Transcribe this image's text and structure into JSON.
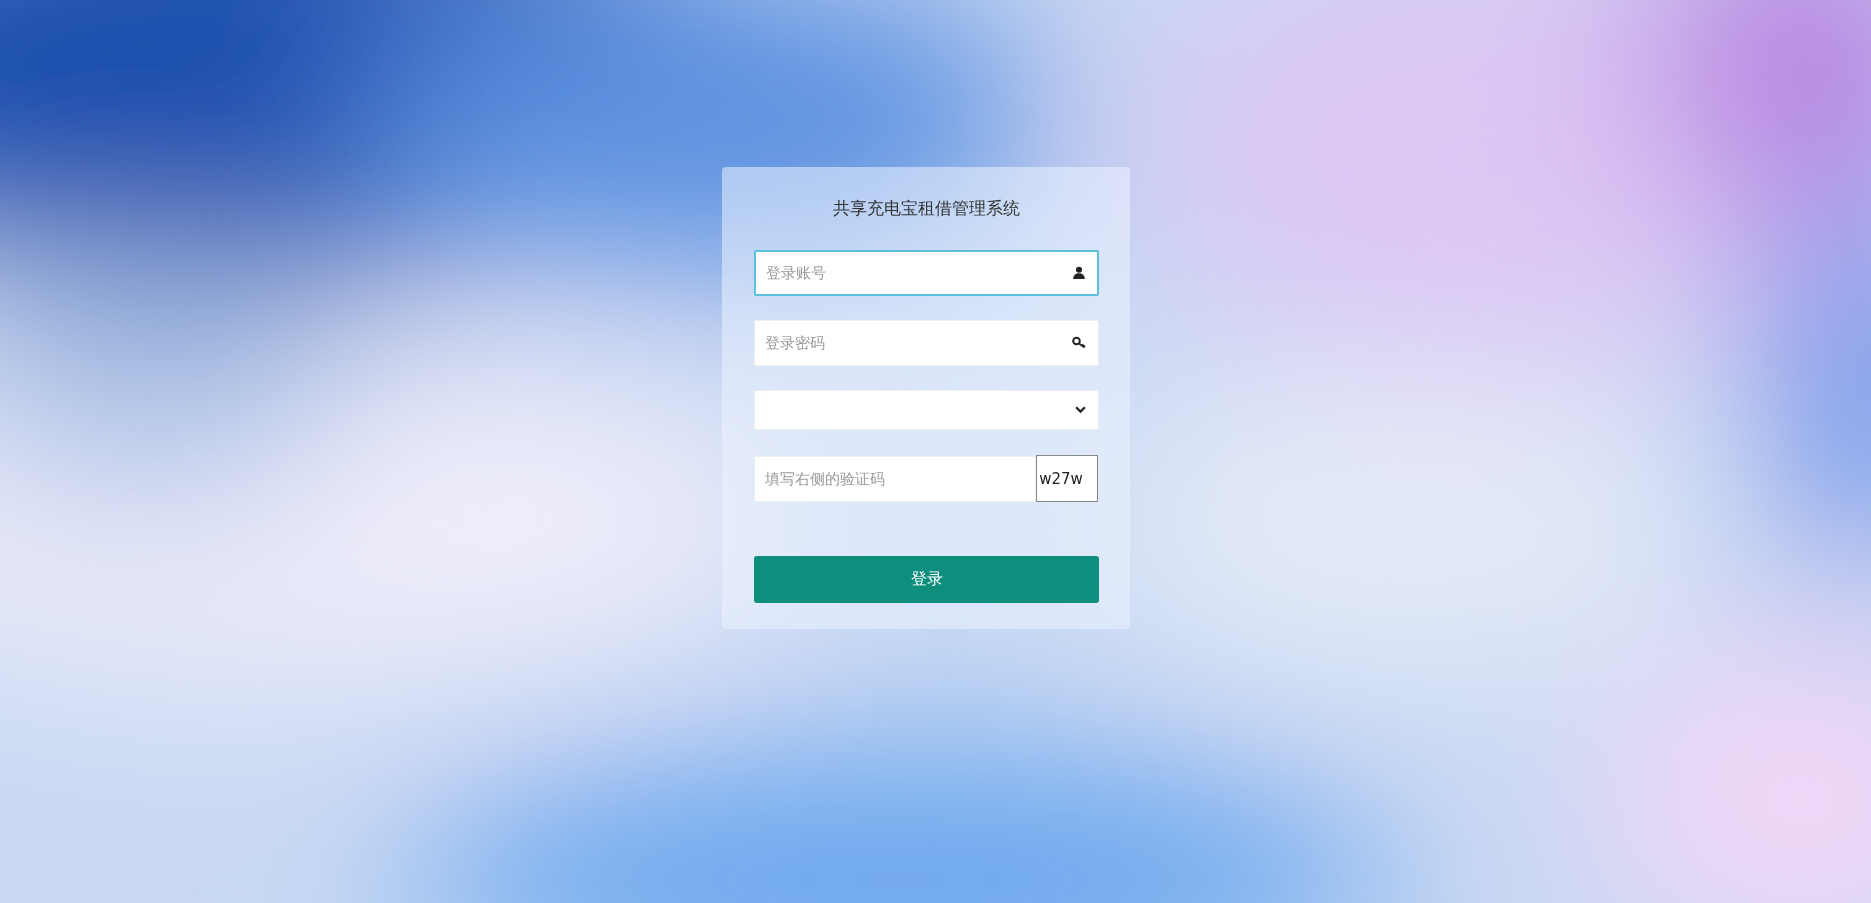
{
  "login_card": {
    "title": "共享充电宝租借管理系统",
    "fields": [
      {
        "kind": "text",
        "placeholder": "登录账号",
        "focused": true
      },
      {
        "kind": "password",
        "placeholder": "登录密码",
        "focused": false
      },
      {
        "kind": "select",
        "focused": false
      },
      {
        "kind": "captcha",
        "placeholder": "填写右侧的验证码",
        "code": "w27w",
        "focused": false
      }
    ],
    "button": "登录"
  }
}
